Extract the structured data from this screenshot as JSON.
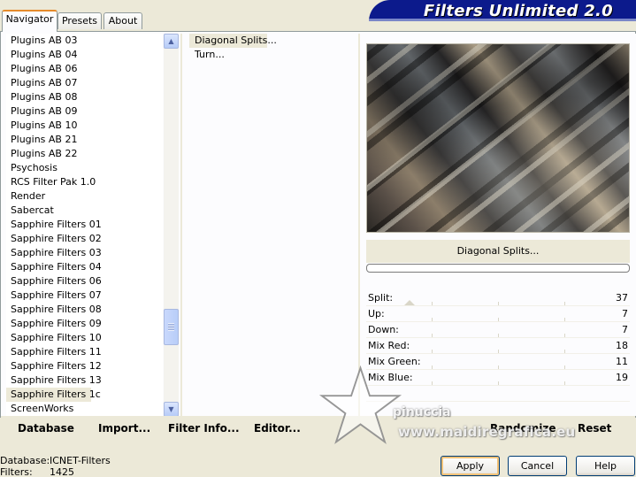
{
  "tabs": [
    {
      "label": "Navigator",
      "active": true
    },
    {
      "label": "Presets",
      "active": false
    },
    {
      "label": "About",
      "active": false
    }
  ],
  "banner_title": "Filters Unlimited 2.0",
  "categories": [
    "Plugins AB 03",
    "Plugins AB 04",
    "Plugins AB 06",
    "Plugins AB 07",
    "Plugins AB 08",
    "Plugins AB 09",
    "Plugins AB 10",
    "Plugins AB 21",
    "Plugins AB 22",
    "Psychosis",
    "RCS Filter Pak 1.0",
    "Render",
    "Sabercat",
    "Sapphire Filters 01",
    "Sapphire Filters 02",
    "Sapphire Filters 03",
    "Sapphire Filters 04",
    "Sapphire Filters 06",
    "Sapphire Filters 07",
    "Sapphire Filters 08",
    "Sapphire Filters 09",
    "Sapphire Filters 10",
    "Sapphire Filters 11",
    "Sapphire Filters 12",
    "Sapphire Filters 13",
    "Sapphire Filters 1c",
    "ScreenWorks"
  ],
  "selected_category": "Sapphire Filters 1c",
  "filters": [
    "Diagonal Splits...",
    "Turn..."
  ],
  "selected_filter": "Diagonal Splits...",
  "preview_filter_name": "Diagonal Splits...",
  "progress_fraction": 0,
  "params": [
    {
      "label": "Split:",
      "value": 37
    },
    {
      "label": "Up:",
      "value": 7
    },
    {
      "label": "Down:",
      "value": 7
    },
    {
      "label": "Mix Red:",
      "value": 18
    },
    {
      "label": "Mix Green:",
      "value": 11
    },
    {
      "label": "Mix Blue:",
      "value": 19
    }
  ],
  "bottom_buttons": {
    "database": "Database",
    "import": "Import...",
    "filter_info": "Filter Info...",
    "editor": "Editor...",
    "randomize": "Randomize",
    "reset": "Reset"
  },
  "watermark": {
    "line1": "pinuccia",
    "line2": "www.maidiregrafica.eu"
  },
  "status": {
    "database_label": "Database:",
    "database_value": "ICNET-Filters",
    "filters_label": "Filters:",
    "filters_value": "1425"
  },
  "dialog_buttons": {
    "apply": "Apply",
    "cancel": "Cancel",
    "help": "Help"
  },
  "colors": {
    "banner": "#0c1a8c",
    "tab_active_accent": "#e68b2c",
    "panel_bg": "#ece9d8"
  }
}
